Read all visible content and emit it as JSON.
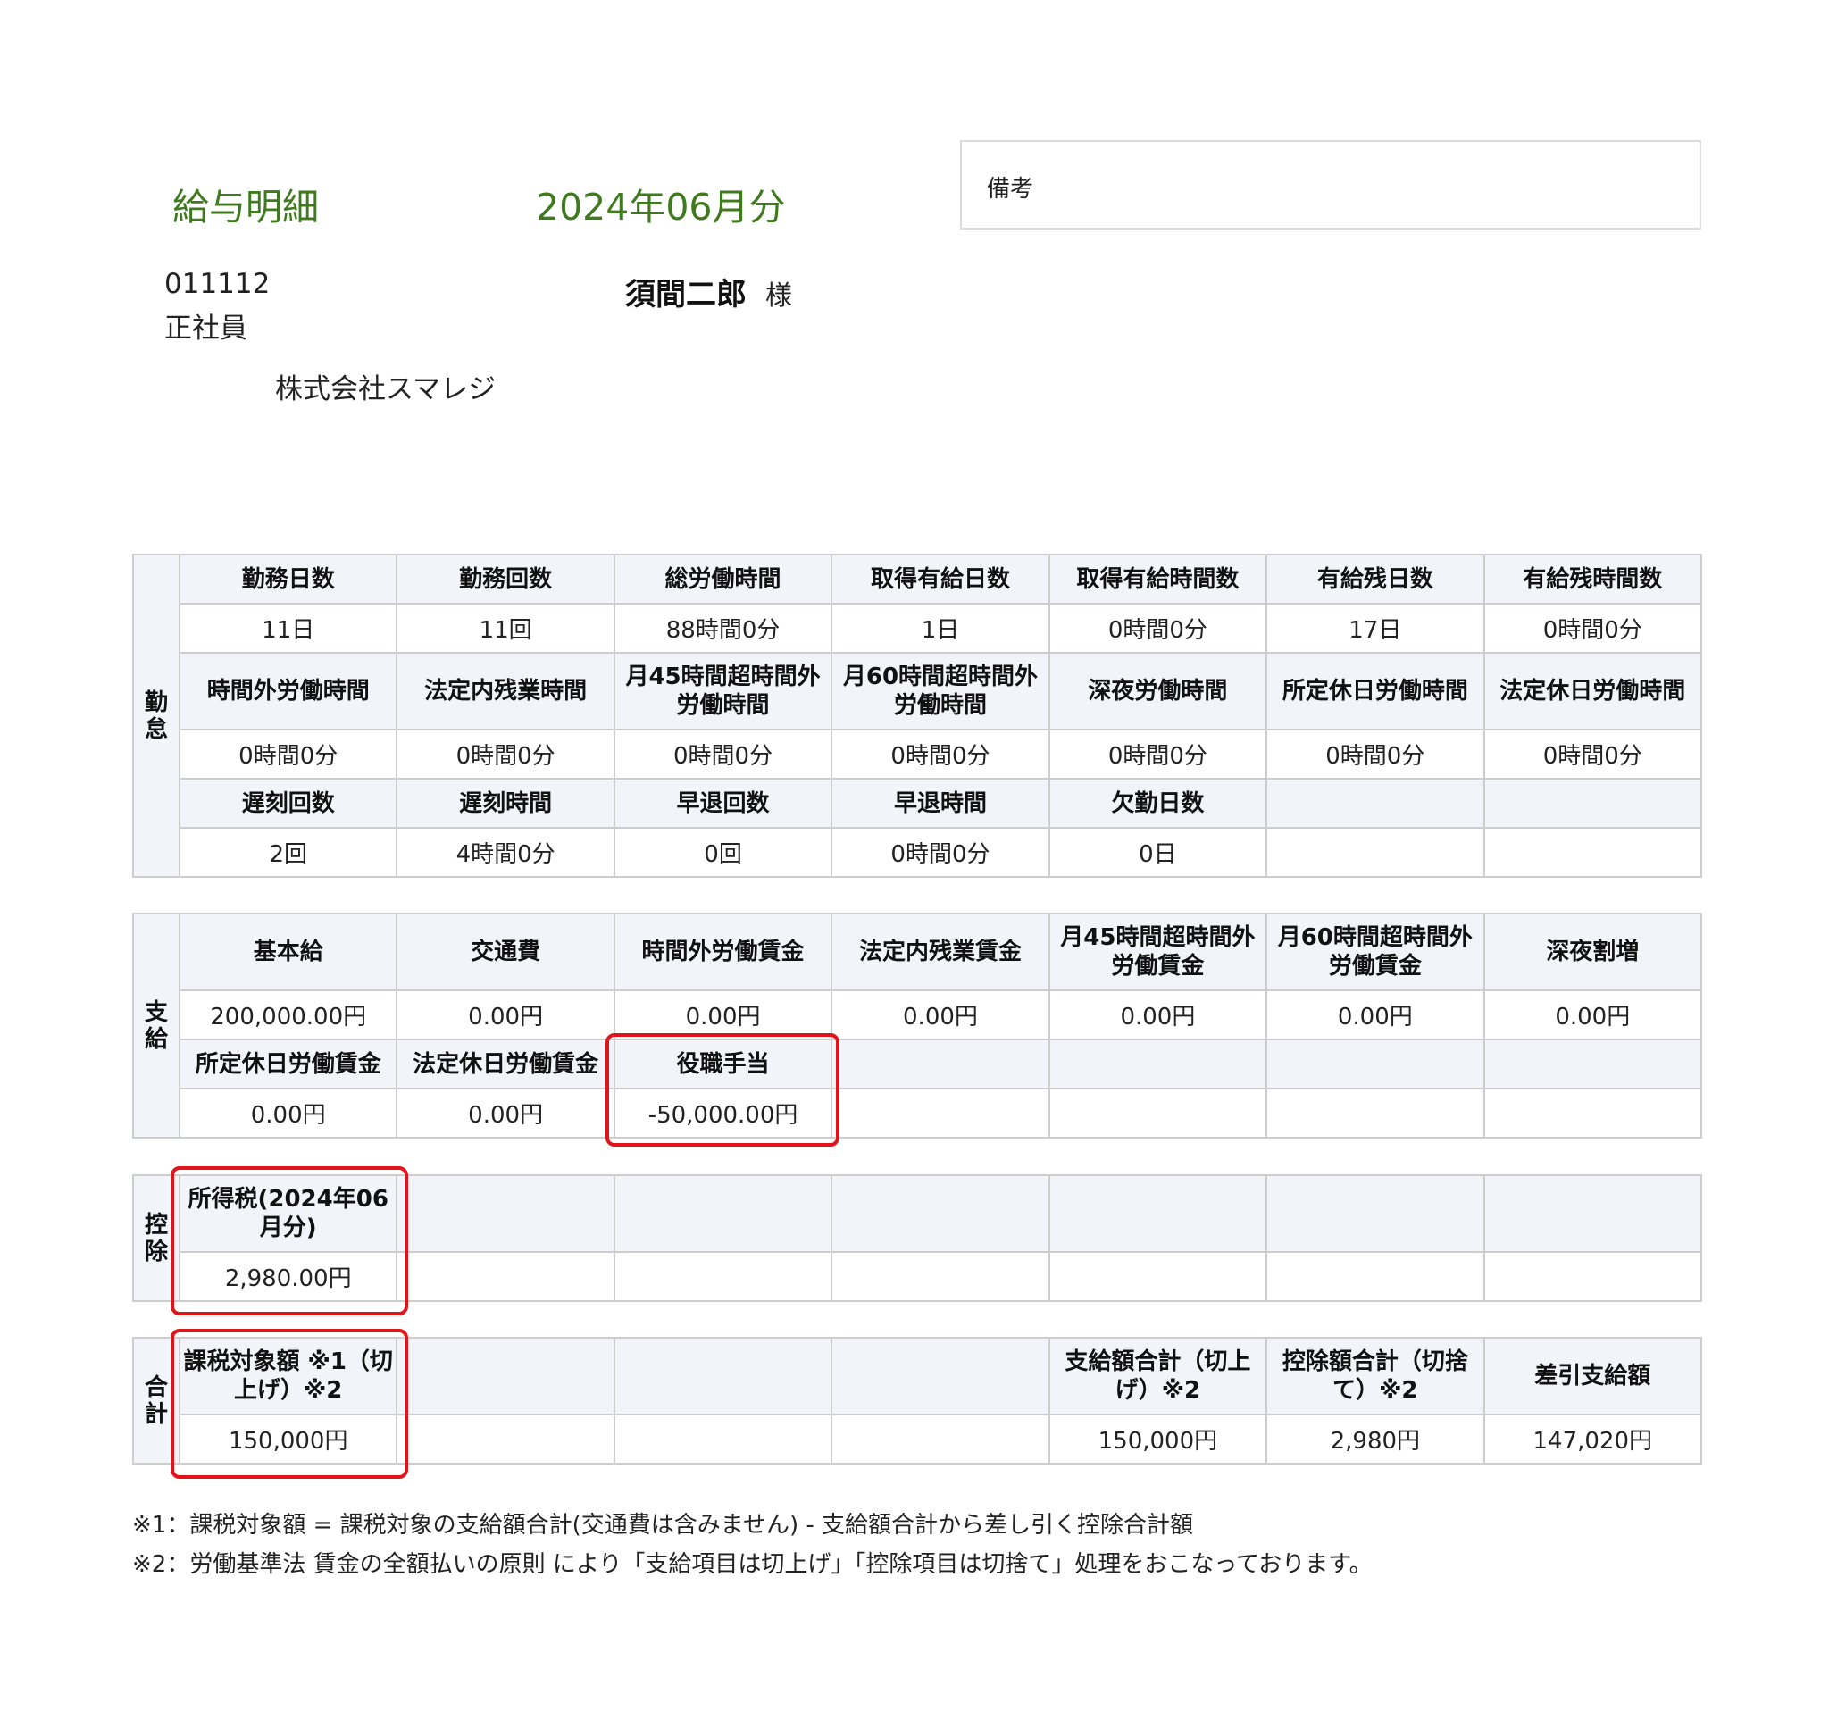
{
  "header": {
    "doc_title": "給与明細",
    "period": "2024年06月分",
    "memo_label": "備考",
    "employee_code": "011112",
    "employee_type": "正社員",
    "employee_name": "須間二郎",
    "honorific": "様",
    "company": "株式会社スマレジ"
  },
  "attendance": {
    "side_label": "勤\n怠",
    "row1_headers": [
      "勤務日数",
      "勤務回数",
      "総労働時間",
      "取得有給日数",
      "取得有給時間数",
      "有給残日数",
      "有給残時間数"
    ],
    "row1_values": [
      "11日",
      "11回",
      "88時間0分",
      "1日",
      "0時間0分",
      "17日",
      "0時間0分"
    ],
    "row2_headers": [
      "時間外労働時間",
      "法定内残業時間",
      "月45時間超時間外労働時間",
      "月60時間超時間外労働時間",
      "深夜労働時間",
      "所定休日労働時間",
      "法定休日労働時間"
    ],
    "row2_values": [
      "0時間0分",
      "0時間0分",
      "0時間0分",
      "0時間0分",
      "0時間0分",
      "0時間0分",
      "0時間0分"
    ],
    "row3_headers": [
      "遅刻回数",
      "遅刻時間",
      "早退回数",
      "早退時間",
      "欠勤日数",
      "",
      ""
    ],
    "row3_values": [
      "2回",
      "4時間0分",
      "0回",
      "0時間0分",
      "0日",
      "",
      ""
    ]
  },
  "payments": {
    "side_label": "支\n給",
    "row1_headers": [
      "基本給",
      "交通費",
      "時間外労働賃金",
      "法定内残業賃金",
      "月45時間超時間外労働賃金",
      "月60時間超時間外労働賃金",
      "深夜割増"
    ],
    "row1_values": [
      "200,000.00円",
      "0.00円",
      "0.00円",
      "0.00円",
      "0.00円",
      "0.00円",
      "0.00円"
    ],
    "row2_headers": [
      "所定休日労働賃金",
      "法定休日労働賃金",
      "役職手当",
      "",
      "",
      "",
      ""
    ],
    "row2_values": [
      "0.00円",
      "0.00円",
      "-50,000.00円",
      "",
      "",
      "",
      ""
    ]
  },
  "deductions": {
    "side_label": "控\n除",
    "headers": [
      "所得税(2024年06月分)",
      "",
      "",
      "",
      "",
      "",
      ""
    ],
    "values": [
      "2,980.00円",
      "",
      "",
      "",
      "",
      "",
      ""
    ]
  },
  "totals": {
    "side_label": "合\n計",
    "headers": [
      "課税対象額 ※1（切上げ）※2",
      "",
      "",
      "",
      "支給額合計（切上げ）※2",
      "控除額合計（切捨て）※2",
      "差引支給額"
    ],
    "values": [
      "150,000円",
      "",
      "",
      "",
      "150,000円",
      "2,980円",
      "147,020円"
    ]
  },
  "notes": {
    "note1": "※1：課税対象額 = 課税対象の支給額合計(交通費は含みません) - 支給額合計から差し引く控除合計額",
    "note2": "※2：労働基準法 賃金の全額払いの原則 により「支給項目は切上げ」「控除項目は切捨て」処理をおこなっております。"
  },
  "colors": {
    "title_green": "#3f7a1f",
    "header_bg": "#f3f4fa",
    "border": "#cdcdcd",
    "highlight_red": "#e0141a"
  }
}
